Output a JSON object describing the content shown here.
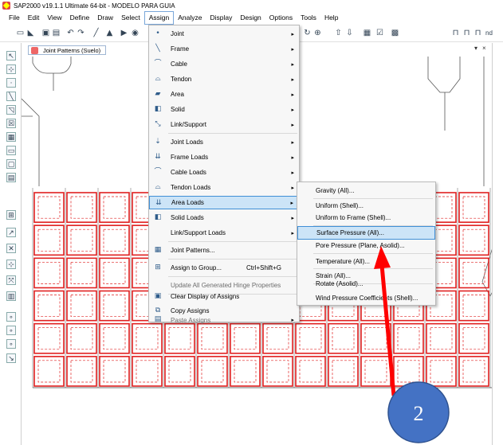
{
  "window": {
    "title": "SAP2000 v19.1.1 Ultimate 64-bit - MODELO PARA GUIA"
  },
  "menubar": [
    "File",
    "Edit",
    "View",
    "Define",
    "Draw",
    "Select",
    "Assign",
    "Analyze",
    "Display",
    "Design",
    "Options",
    "Tools",
    "Help"
  ],
  "toolbar": {
    "partial_label": "nd"
  },
  "view": {
    "tab_title": "Joint Patterns (Suelo)",
    "dropdown_glyph": "▾",
    "close_glyph": "×"
  },
  "assign_menu": [
    {
      "label": "Joint",
      "icon": "joint-icon",
      "submenu": true
    },
    {
      "label": "Frame",
      "icon": "frame-icon",
      "submenu": true
    },
    {
      "label": "Cable",
      "icon": "cable-icon",
      "submenu": true
    },
    {
      "label": "Tendon",
      "icon": "tendon-icon",
      "submenu": true
    },
    {
      "label": "Area",
      "icon": "area-icon",
      "submenu": true
    },
    {
      "label": "Solid",
      "icon": "solid-icon",
      "submenu": true
    },
    {
      "label": "Link/Support",
      "icon": "link-support-icon",
      "submenu": true
    },
    {
      "label": "Joint Loads",
      "icon": "joint-loads-icon",
      "submenu": true
    },
    {
      "label": "Frame Loads",
      "icon": "frame-loads-icon",
      "submenu": true
    },
    {
      "label": "Cable Loads",
      "icon": "cable-loads-icon",
      "submenu": true
    },
    {
      "label": "Tendon Loads",
      "icon": "tendon-loads-icon",
      "submenu": true
    },
    {
      "label": "Area Loads",
      "icon": "area-loads-icon",
      "submenu": true,
      "highlighted": true
    },
    {
      "label": "Solid Loads",
      "icon": "solid-loads-icon",
      "submenu": true
    },
    {
      "label": "Link/Support Loads",
      "icon": "",
      "submenu": true
    },
    {
      "label": "Joint Patterns...",
      "icon": "joint-patterns-icon"
    },
    {
      "label": "Assign to Group...",
      "icon": "assign-group-icon",
      "shortcut": "Ctrl+Shift+G"
    },
    {
      "label": "Update All Generated Hinge Properties",
      "icon": "",
      "disabled": true
    },
    {
      "label": "Clear Display of Assigns",
      "icon": "clear-display-icon"
    },
    {
      "label": "Copy Assigns",
      "icon": "copy-assigns-icon"
    },
    {
      "label": "Paste Assigns",
      "icon": "paste-assigns-icon",
      "disabled": true,
      "submenu": true
    }
  ],
  "area_loads_menu": [
    {
      "label": "Gravity (All)..."
    },
    {
      "label": "Uniform (Shell)..."
    },
    {
      "label": "Uniform to Frame (Shell)..."
    },
    {
      "label": "Surface Pressure (All)...",
      "highlighted": true
    },
    {
      "label": "Pore Pressure (Plane, Asolid)..."
    },
    {
      "label": "Temperature (All)..."
    },
    {
      "label": "Strain (All)..."
    },
    {
      "label": "Rotate (Asolid)..."
    },
    {
      "label": "Wind Pressure Coefficients (Shell)..."
    }
  ],
  "annotation": {
    "step_number": "2",
    "arrow_color": "#ff0000",
    "circle_color": "#4472c4"
  },
  "colors": {
    "grid": "#e02020",
    "menu_highlight": "#cce4f7",
    "menu_highlight_border": "#3f8fd6"
  }
}
